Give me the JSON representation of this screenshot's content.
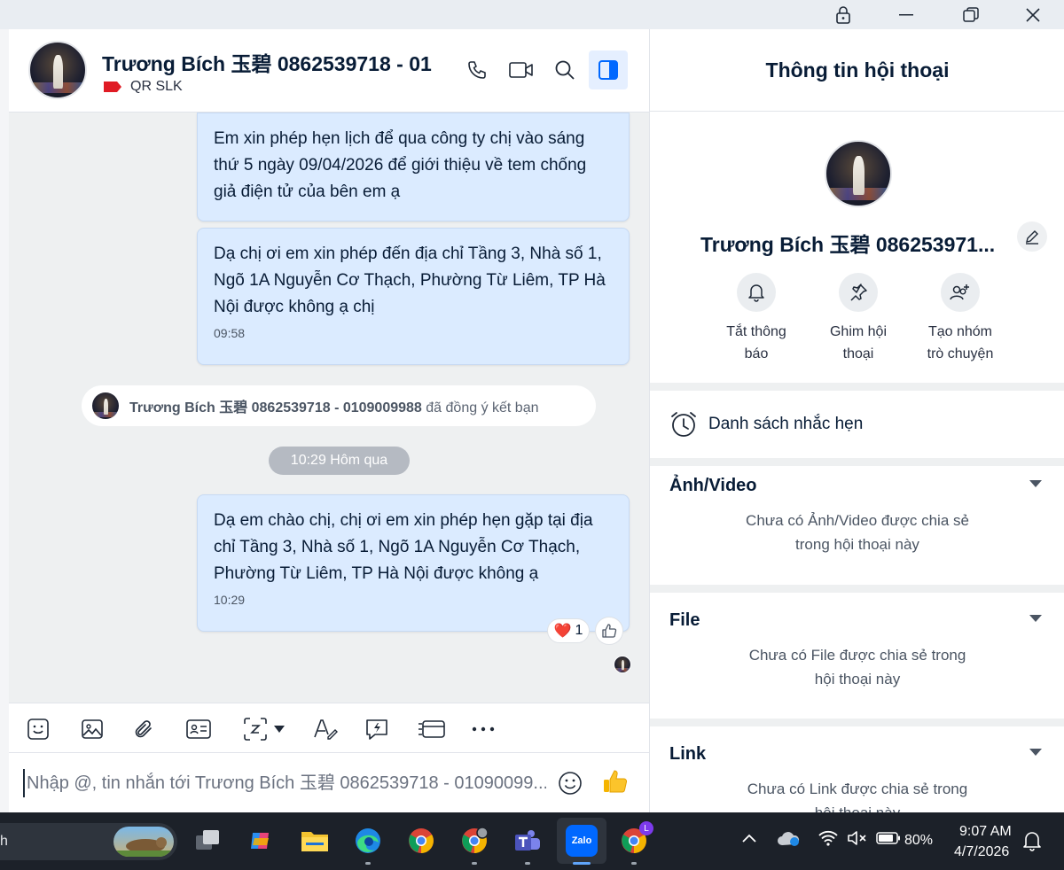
{
  "chat": {
    "contact_name": "Trương Bích 玉碧 0862539718 - 01",
    "tag_label": "QR SLK",
    "messages": [
      {
        "text": "Em xin phép hẹn lịch để qua công ty chị vào sáng thứ 5 ngày 09/04/2026 để giới thiệu về tem chống giả điện tử của bên em ạ",
        "time": ""
      },
      {
        "text": "Dạ chị ơi em xin phép đến địa chỉ Tầng 3, Nhà số 1, Ngõ 1A Nguyễn Cơ Thạch, Phường Từ Liêm, TP Hà Nội được không ạ chị",
        "time": "09:58"
      },
      {
        "text": "Dạ em chào chị, chị ơi em xin phép hẹn gặp tại địa chỉ Tầng 3, Nhà số 1, Ngõ 1A Nguyễn Cơ Thạch, Phường Từ Liêm, TP Hà Nội được không ạ",
        "time": "10:29"
      }
    ],
    "system_notice": {
      "name": "Trương Bích 玉碧 0862539718 - 0109009988",
      "suffix": "đã đồng ý kết bạn"
    },
    "time_divider": "10:29 Hôm qua",
    "reaction": {
      "emoji": "❤️",
      "count": "1"
    },
    "input_placeholder": "Nhập @, tin nhắn tới Trương Bích 玉碧 0862539718 - 01090099..."
  },
  "info": {
    "title": "Thông tin hội thoại",
    "name": "Trương Bích 玉碧 086253971...",
    "actions": [
      {
        "line1": "Tắt thông",
        "line2": "báo",
        "icon": "bell-icon"
      },
      {
        "line1": "Ghim hội",
        "line2": "thoại",
        "icon": "pin-icon"
      },
      {
        "line1": "Tạo nhóm",
        "line2": "trò chuyện",
        "icon": "add-group-icon"
      }
    ],
    "reminder_label": "Danh sách nhắc hẹn",
    "sections": [
      {
        "title": "Ảnh/Video",
        "empty_line1": "Chưa có Ảnh/Video được chia sẻ",
        "empty_line2": "trong hội thoại này"
      },
      {
        "title": "File",
        "empty_line1": "Chưa có File được chia sẻ trong",
        "empty_line2": "hội thoại này"
      },
      {
        "title": "Link",
        "empty_line1": "Chưa có Link được chia sẻ trong",
        "empty_line2": "hội thoại này"
      }
    ]
  },
  "taskbar": {
    "search_text": "h",
    "zalo_label": "Zalo",
    "battery": "80%",
    "time": "9:07 AM",
    "date": "4/7/2026",
    "chrome_badge": "L"
  },
  "colors": {
    "bubble": "#dbebff",
    "accent": "#0068ff",
    "tag_red": "#e01b24",
    "taskbar": "#1c2129"
  }
}
